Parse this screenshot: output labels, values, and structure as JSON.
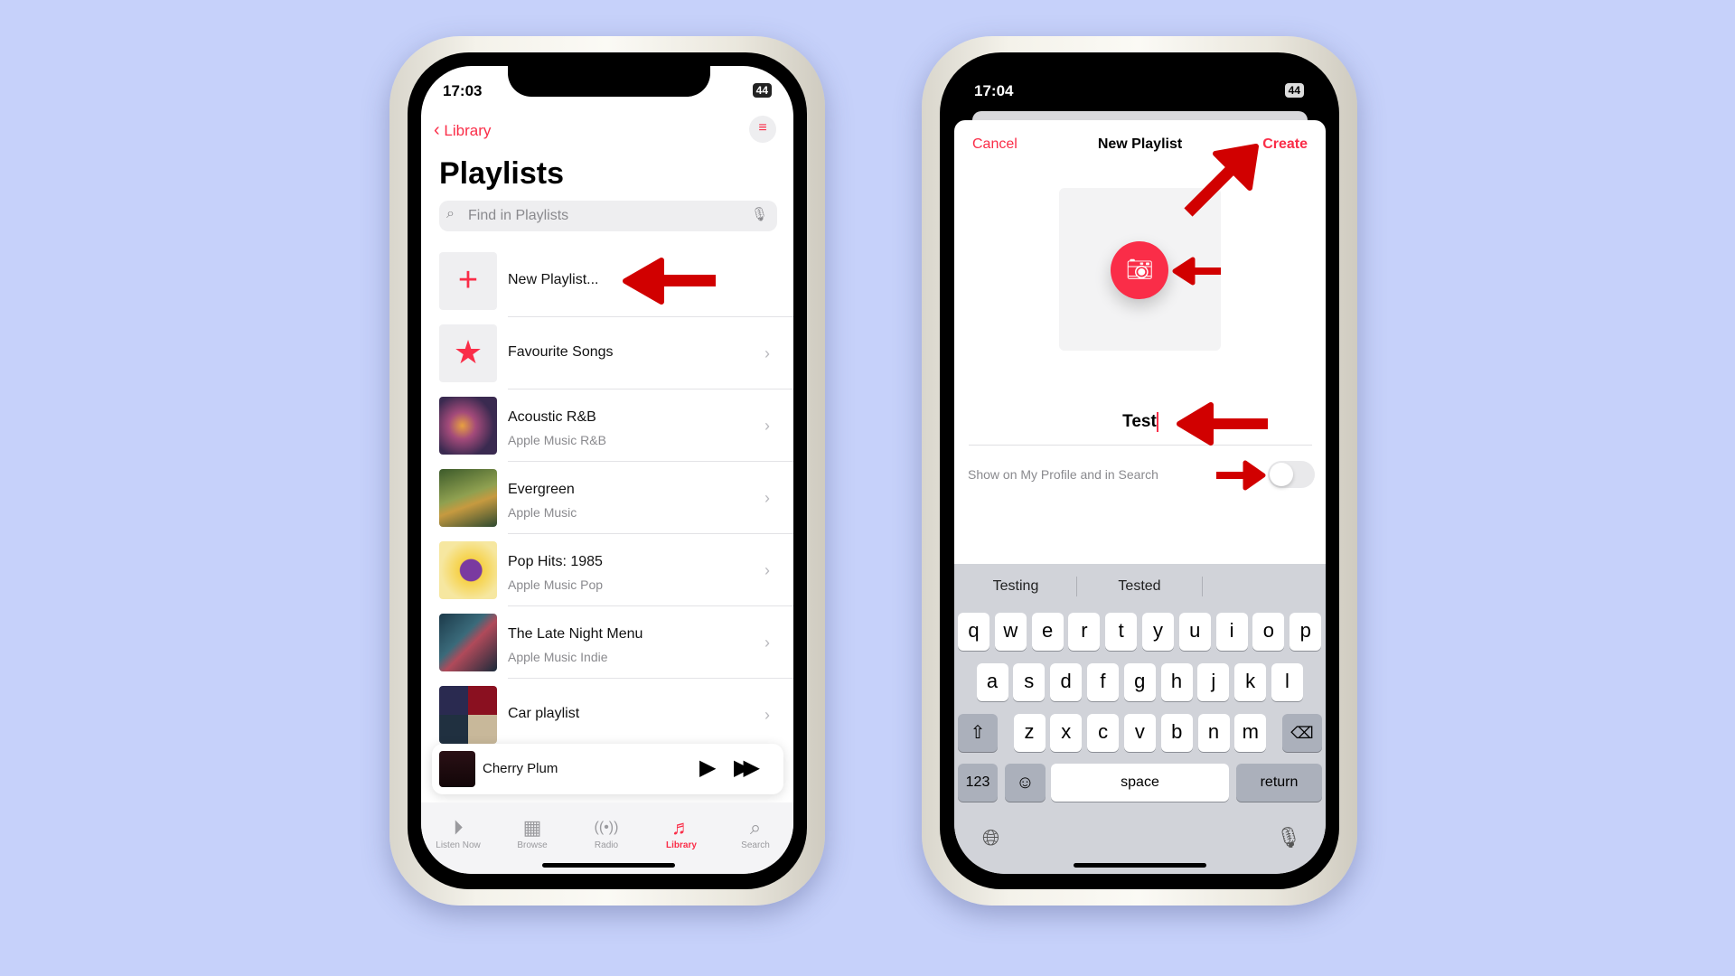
{
  "left_phone": {
    "status": {
      "time": "17:03",
      "battery": "44"
    },
    "nav": {
      "back_label": "Library",
      "filter_icon": "filter-icon"
    },
    "title": "Playlists",
    "search": {
      "placeholder": "Find in Playlists"
    },
    "new_playlist_label": "New Playlist...",
    "playlists": [
      {
        "title": "Favourite Songs",
        "subtitle": ""
      },
      {
        "title": "Acoustic R&B",
        "subtitle": "Apple Music R&B"
      },
      {
        "title": "Evergreen",
        "subtitle": "Apple Music"
      },
      {
        "title": "Pop Hits: 1985",
        "subtitle": "Apple Music Pop"
      },
      {
        "title": "The Late Night Menu",
        "subtitle": "Apple Music Indie"
      },
      {
        "title": "Car playlist",
        "subtitle": ""
      }
    ],
    "mini_player": {
      "track": "Cherry Plum"
    },
    "tabs": [
      {
        "label": "Listen Now",
        "active": false
      },
      {
        "label": "Browse",
        "active": false
      },
      {
        "label": "Radio",
        "active": false
      },
      {
        "label": "Library",
        "active": true
      },
      {
        "label": "Search",
        "active": false
      }
    ]
  },
  "right_phone": {
    "status": {
      "time": "17:04",
      "battery": "44"
    },
    "sheet": {
      "cancel_label": "Cancel",
      "title": "New Playlist",
      "create_label": "Create"
    },
    "name_value": "Test",
    "toggle": {
      "label": "Show on My Profile and in Search",
      "on": false
    },
    "suggestions": [
      "Testing",
      "Tested",
      ""
    ],
    "keyboard": {
      "row1": [
        "q",
        "w",
        "e",
        "r",
        "t",
        "y",
        "u",
        "i",
        "o",
        "p"
      ],
      "row2": [
        "a",
        "s",
        "d",
        "f",
        "g",
        "h",
        "j",
        "k",
        "l"
      ],
      "row3": [
        "z",
        "x",
        "c",
        "v",
        "b",
        "n",
        "m"
      ],
      "numbers_label": "123",
      "space_label": "space",
      "return_label": "return"
    }
  },
  "colors": {
    "accent": "#fa2d48",
    "annotation_arrow": "#d10000",
    "background": "#c6d1fa"
  }
}
